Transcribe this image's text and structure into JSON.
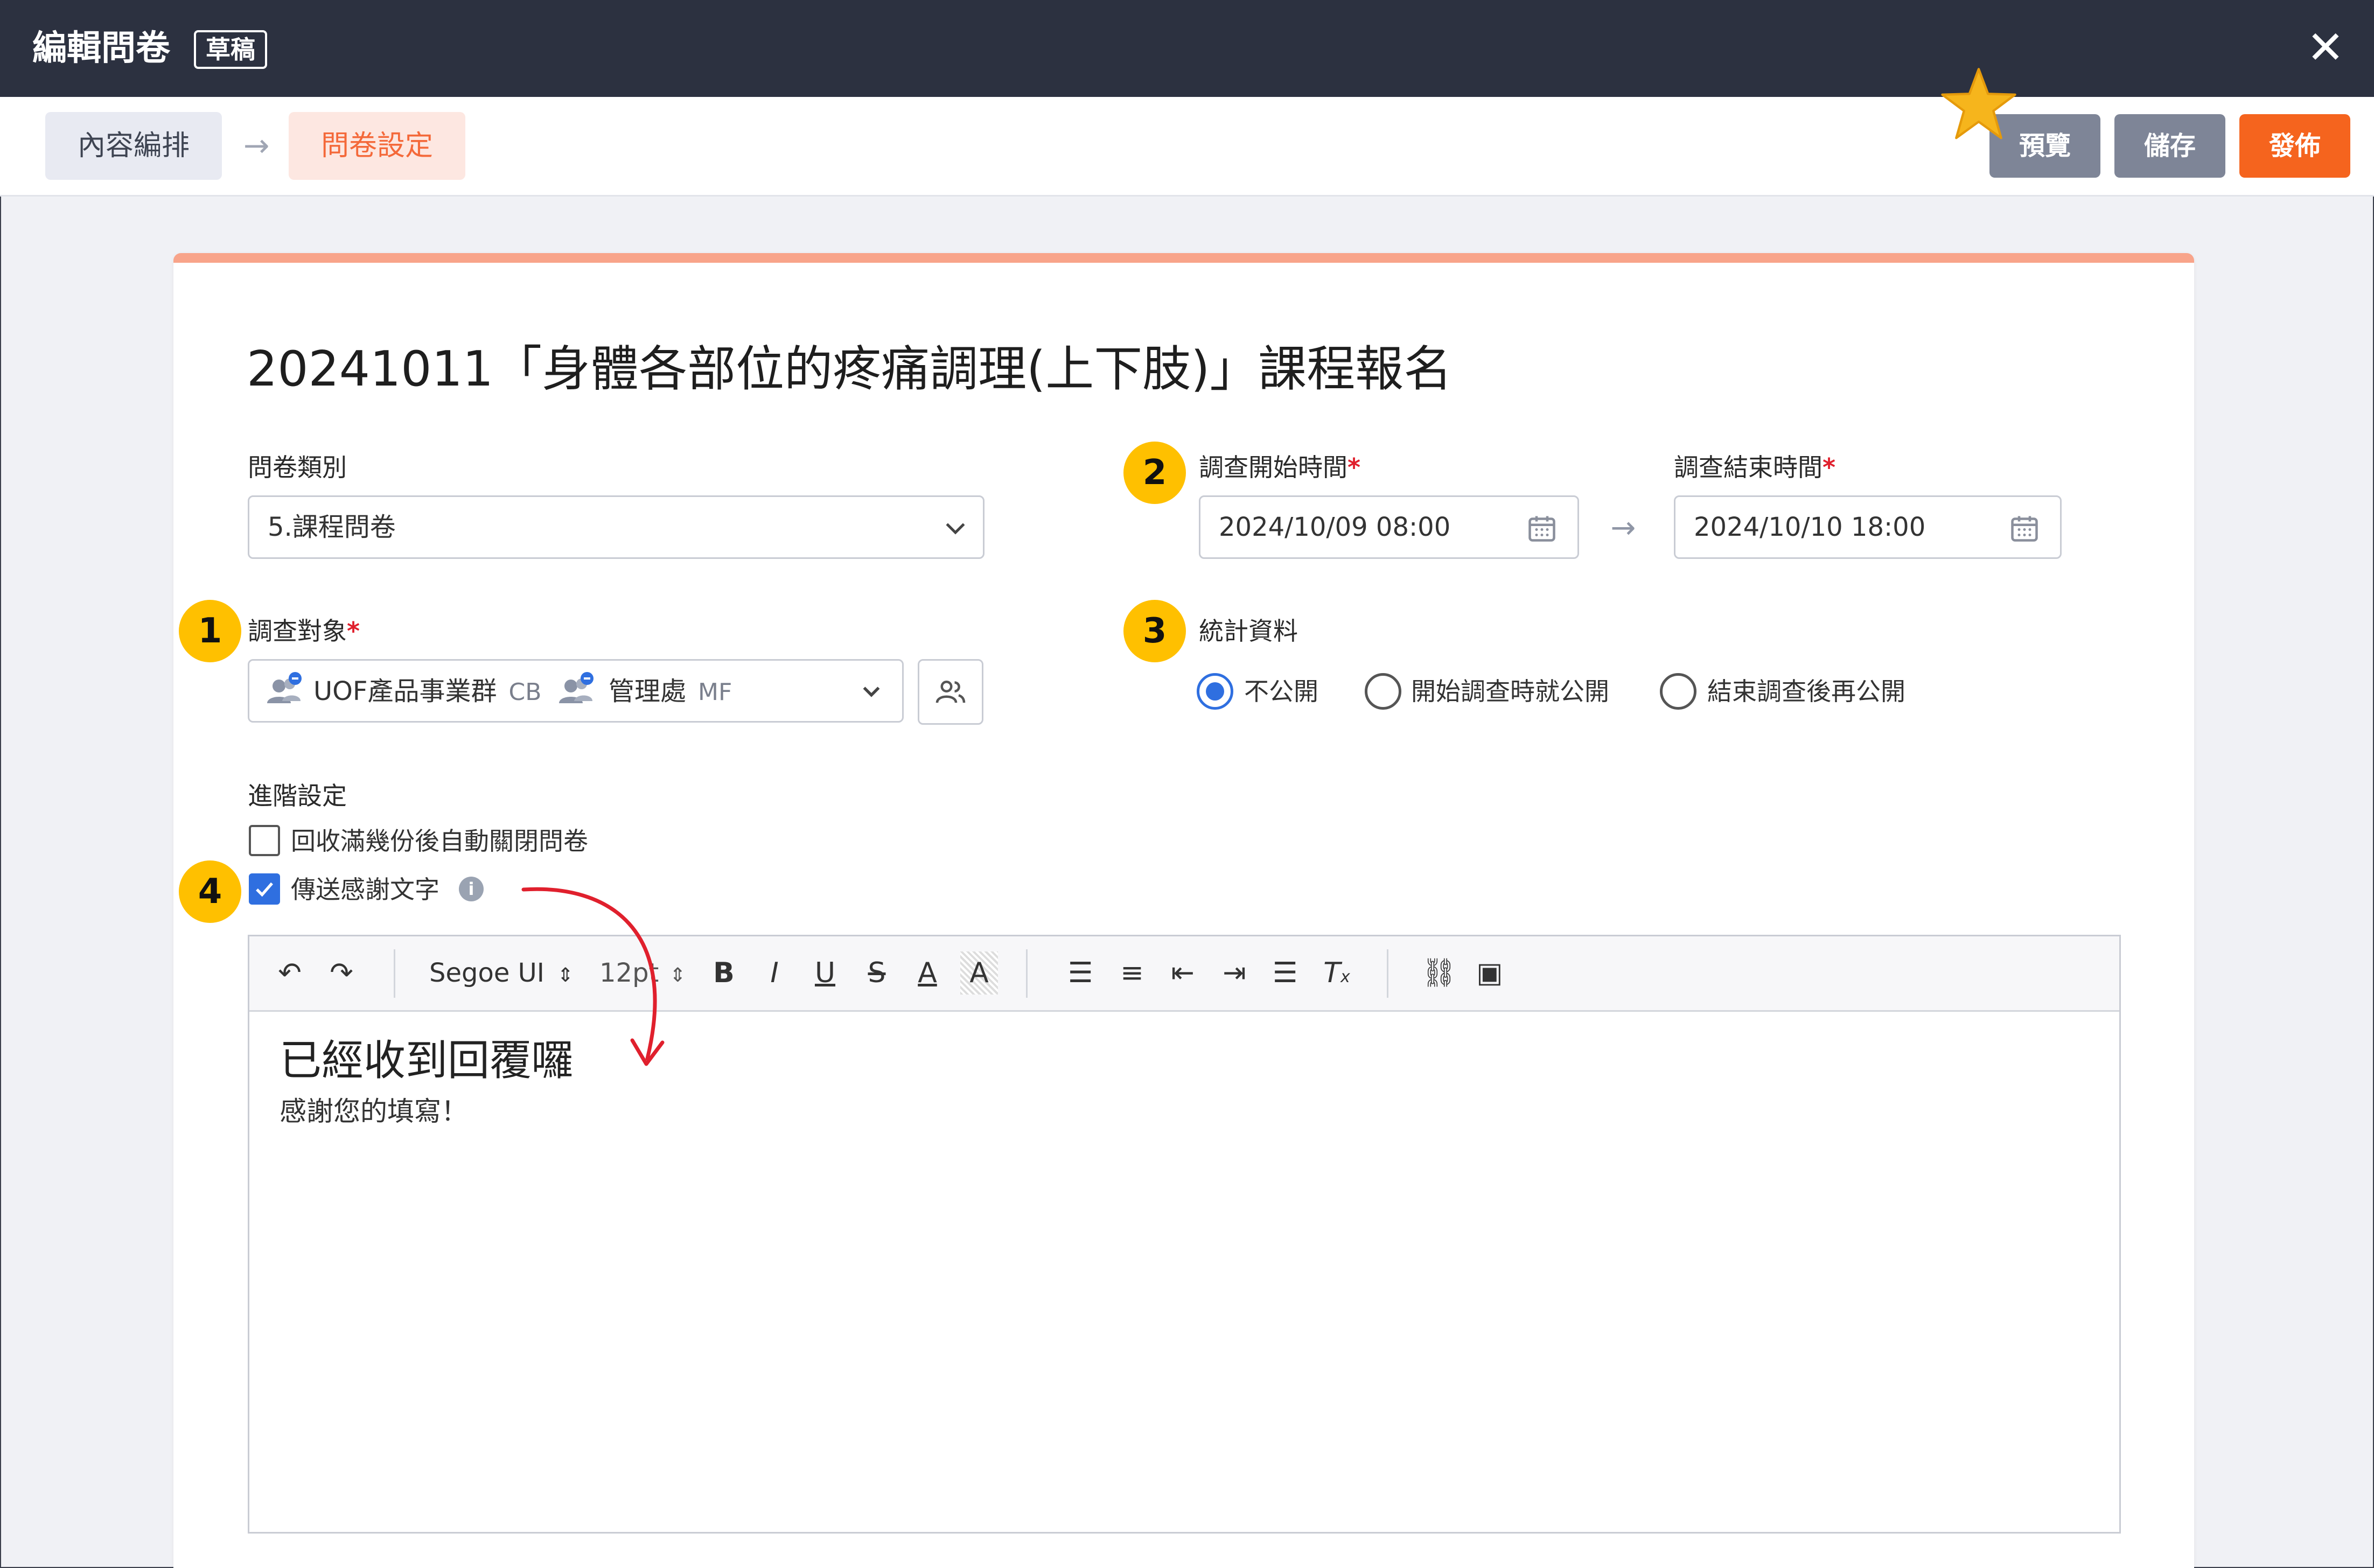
{
  "window": {
    "title": "編輯問卷",
    "status_badge": "草稿",
    "close_symbol": "✕"
  },
  "toolbar": {
    "steps": [
      "內容編排",
      "問卷設定"
    ],
    "active_step": "問卷設定",
    "preview_label": "預覽",
    "save_label": "儲存",
    "publish_label": "發佈"
  },
  "colors": {
    "accent": "#f5641e",
    "header_bg": "#2c3140",
    "primary": "#2f6fe0",
    "annotation": "#ffc000",
    "card_top": "#f8a48a"
  },
  "form": {
    "survey_title": "20241011「身體各部位的疼痛調理(上下肢)」課程報名",
    "category": {
      "label": "問卷類別",
      "value": "5.課程問卷"
    },
    "start_time": {
      "label": "調查開始時間",
      "required_mark": "*",
      "value": "2024/10/09 08:00"
    },
    "end_time": {
      "label": "調查結束時間",
      "required_mark": "*",
      "value": "2024/10/10 18:00"
    },
    "target": {
      "label": "調查對象",
      "required_mark": "*",
      "chips": [
        {
          "name": "UOF產品事業群",
          "code": "CB"
        },
        {
          "name": "管理處",
          "code": "MF"
        }
      ]
    },
    "statistics": {
      "label": "統計資料",
      "options": [
        "不公開",
        "開始調查時就公開",
        "結束調查後再公開"
      ],
      "selected": "不公開"
    },
    "advanced": {
      "label": "進階設定",
      "auto_close": {
        "label": "回收滿幾份後自動關閉問卷",
        "checked": false
      },
      "thank_you": {
        "label": "傳送感謝文字",
        "checked": true
      }
    }
  },
  "editor": {
    "font": "Segoe UI",
    "size": "12pt",
    "heading": "已經收到回覆囉",
    "body": "感謝您的填寫！"
  },
  "annotations": [
    "1",
    "2",
    "3",
    "4"
  ]
}
